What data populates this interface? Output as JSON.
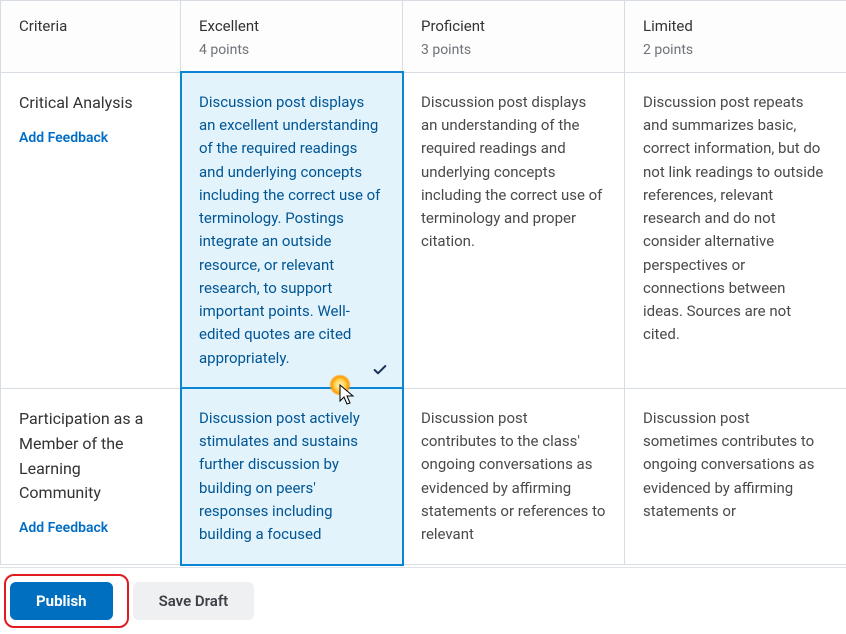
{
  "header": {
    "criteria_label": "Criteria",
    "levels": [
      {
        "title": "Excellent",
        "points": "4 points"
      },
      {
        "title": "Proficient",
        "points": "3 points"
      },
      {
        "title": "Limited",
        "points": "2 points"
      }
    ]
  },
  "rows": [
    {
      "name": "Critical Analysis",
      "feedback_label": "Add Feedback",
      "cells": [
        "Discussion post displays an excellent understanding of the required readings and underlying concepts including the correct use of terminology. Postings integrate an outside resource, or relevant research, to support important points. Well-edited quotes are cited appropriately.",
        "Discussion post displays an understanding of the required readings and underlying concepts including the correct use of terminology and proper citation.",
        "Discussion post repeats and summarizes basic, correct information, but do not link readings to outside references, relevant research and do not consider alternative perspectives or connections between ideas. Sources are not cited."
      ],
      "selected_index": 0
    },
    {
      "name": "Participation as a Member of the Learning Community",
      "feedback_label": "Add Feedback",
      "cells": [
        "Discussion post actively stimulates and sustains further discussion by building on peers' responses including building a focused",
        "Discussion post contributes to the class' ongoing conversations as evidenced by affirming statements or references to relevant",
        "Discussion post sometimes contributes to ongoing conversations as evidenced by affirming statements or"
      ],
      "selected_index": 0
    }
  ],
  "actions": {
    "publish_label": "Publish",
    "save_draft_label": "Save Draft"
  }
}
